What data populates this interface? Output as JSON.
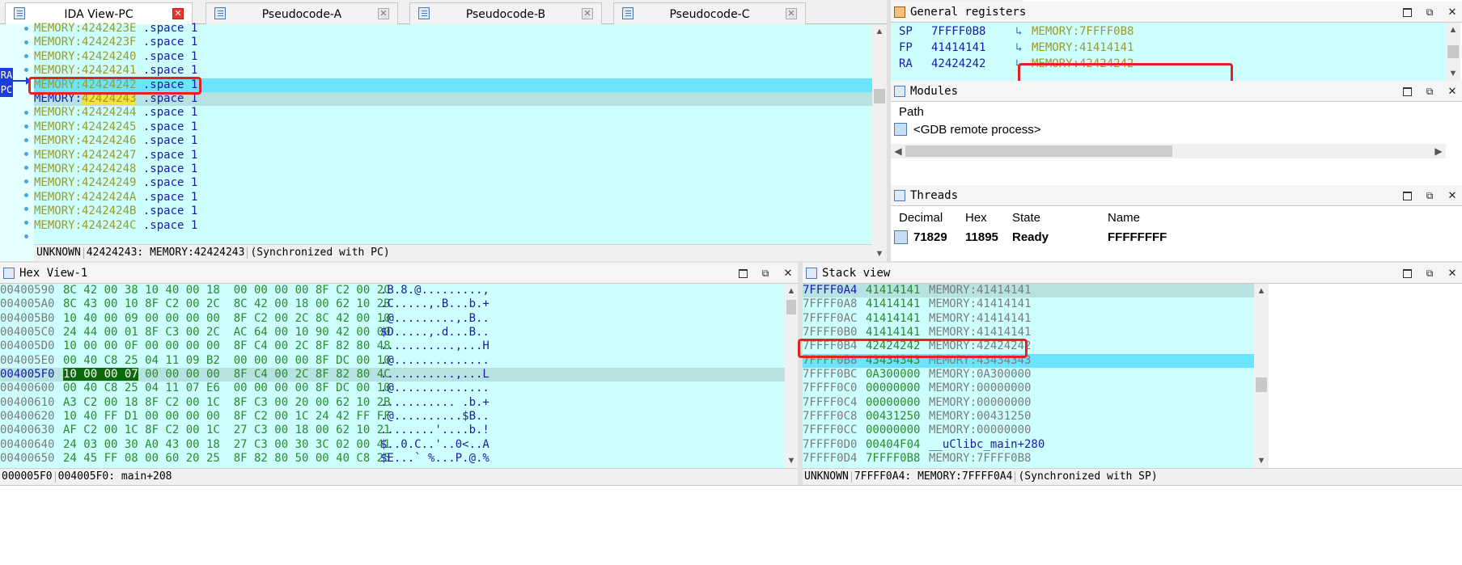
{
  "tabs": [
    {
      "label": "IDA View-PC",
      "active": true
    },
    {
      "label": "Pseudocode-A",
      "active": false
    },
    {
      "label": "Pseudocode-B",
      "active": false
    },
    {
      "label": "Pseudocode-C",
      "active": false
    }
  ],
  "ida_view": {
    "pc_marker": [
      "RA",
      "PC"
    ],
    "rows": [
      {
        "addr": "MEMORY:4242423E",
        "op": ".space 1"
      },
      {
        "addr": "MEMORY:4242423F",
        "op": ".space 1"
      },
      {
        "addr": "MEMORY:42424240",
        "op": ".space 1"
      },
      {
        "addr": "MEMORY:42424241",
        "op": ".space 1"
      },
      {
        "addr": "MEMORY:42424242",
        "op": ".space 1"
      },
      {
        "addr_prefix": "MEMORY:",
        "addr_hl": "42424243",
        "op": ".space 1"
      },
      {
        "addr": "MEMORY:42424244",
        "op": ".space 1"
      },
      {
        "addr": "MEMORY:42424245",
        "op": ".space 1"
      },
      {
        "addr": "MEMORY:42424246",
        "op": ".space 1"
      },
      {
        "addr": "MEMORY:42424247",
        "op": ".space 1"
      },
      {
        "addr": "MEMORY:42424248",
        "op": ".space 1"
      },
      {
        "addr": "MEMORY:42424249",
        "op": ".space 1"
      },
      {
        "addr": "MEMORY:4242424A",
        "op": ".space 1"
      },
      {
        "addr": "MEMORY:4242424B",
        "op": ".space 1"
      },
      {
        "addr": "MEMORY:4242424C",
        "op": ".space 1"
      }
    ],
    "status": {
      "part1": "UNKNOWN",
      "part2": "42424243: MEMORY:42424243",
      "part3": "(Synchronized with PC)"
    }
  },
  "registers": {
    "title": "General registers",
    "rows": [
      {
        "name": "SP",
        "value": "7FFFF0B8",
        "target": "MEMORY:7FFFF0B8"
      },
      {
        "name": "FP",
        "value": "41414141",
        "target": "MEMORY:41414141"
      },
      {
        "name": "RA",
        "value": "42424242",
        "target": "MEMORY:42424242"
      }
    ]
  },
  "modules": {
    "title": "Modules",
    "header": "Path",
    "item": "<GDB remote process>"
  },
  "threads": {
    "title": "Threads",
    "headers": [
      "Decimal",
      "Hex",
      "State",
      "Name"
    ],
    "row": {
      "decimal": "71829",
      "hex": "11895",
      "state": "Ready",
      "name": "FFFFFFFF"
    }
  },
  "hex_view": {
    "title": "Hex View-1",
    "rows": [
      {
        "addr": "00400590",
        "bytes": "8C 42 00 38 10 40 00 18  00 00 00 00 8F C2 00 2C",
        "ascii": ".B.8.@.........,"
      },
      {
        "addr": "004005A0",
        "bytes": "8C 43 00 10 8F C2 00 2C  8C 42 00 18 00 62 10 2B",
        "ascii": ".C.....,.B...b.+"
      },
      {
        "addr": "004005B0",
        "bytes": "10 40 00 09 00 00 00 00  8F C2 00 2C 8C 42 00 10",
        "ascii": ".@.........,.B.."
      },
      {
        "addr": "004005C0",
        "bytes": "24 44 00 01 8F C3 00 2C  AC 64 00 10 90 42 00 00",
        "ascii": "$D.....,.d...B.."
      },
      {
        "addr": "004005D0",
        "bytes": "10 00 00 0F 00 00 00 00  8F C4 00 2C 8F 82 80 48",
        "ascii": "...........,...H"
      },
      {
        "addr": "004005E0",
        "bytes": "00 40 C8 25 04 11 09 B2  00 00 00 00 8F DC 00 10",
        "ascii": ".@.............."
      },
      {
        "addr": "004005F0",
        "bytes_hl": "10 00 00 07",
        "bytes": " 00 00 00 00  8F C4 00 2C 8F 82 80 4C",
        "ascii": "...........,...L"
      },
      {
        "addr": "00400600",
        "bytes": "00 40 C8 25 04 11 07 E6  00 00 00 00 8F DC 00 10",
        "ascii": ".@.............."
      },
      {
        "addr": "00400610",
        "bytes": "A3 C2 00 18 8F C2 00 1C  8F C3 00 20 00 62 10 2B",
        "ascii": "........... .b.+"
      },
      {
        "addr": "00400620",
        "bytes": "10 40 FF D1 00 00 00 00  8F C2 00 1C 24 42 FF FF",
        "ascii": ".@..........$B.."
      },
      {
        "addr": "00400630",
        "bytes": "AF C2 00 1C 8F C2 00 1C  27 C3 00 18 00 62 10 21",
        "ascii": "........'....b.!"
      },
      {
        "addr": "00400640",
        "bytes": "24 03 00 30 A0 43 00 18  27 C3 00 30 3C 02 00 41",
        "ascii": "$..0.C..'..0<..A"
      },
      {
        "addr": "00400650",
        "bytes": "24 45 FF 08 00 60 20 25  8F 82 80 50 00 40 C8 25",
        "ascii": "$E...` %...P.@.%"
      }
    ],
    "status": {
      "part1": "000005F0",
      "part2": "004005F0: main+208"
    }
  },
  "stack_view": {
    "title": "Stack view",
    "rows": [
      {
        "addr": "7FFFF0A4",
        "value": "41414141",
        "target": "MEMORY:41414141"
      },
      {
        "addr": "7FFFF0A8",
        "value": "41414141",
        "target": "MEMORY:41414141"
      },
      {
        "addr": "7FFFF0AC",
        "value": "41414141",
        "target": "MEMORY:41414141"
      },
      {
        "addr": "7FFFF0B0",
        "value": "41414141",
        "target": "MEMORY:41414141"
      },
      {
        "addr": "7FFFF0B4",
        "value": "42424242",
        "target": "MEMORY:42424242"
      },
      {
        "addr": "7FFFF0B8",
        "value": "43434343",
        "target": "MEMORY:43434343"
      },
      {
        "addr": "7FFFF0BC",
        "value": "0A300000",
        "target": "MEMORY:0A300000"
      },
      {
        "addr": "7FFFF0C0",
        "value": "00000000",
        "target": "MEMORY:00000000"
      },
      {
        "addr": "7FFFF0C4",
        "value": "00000000",
        "target": "MEMORY:00000000"
      },
      {
        "addr": "7FFFF0C8",
        "value": "00431250",
        "target": "MEMORY:00431250"
      },
      {
        "addr": "7FFFF0CC",
        "value": "00000000",
        "target": "MEMORY:00000000"
      },
      {
        "addr": "7FFFF0D0",
        "value": "00404F04",
        "target": "__uClibc_main+280"
      },
      {
        "addr": "7FFFF0D4",
        "value": "7FFFF0B8",
        "target": "MEMORY:7FFFF0B8"
      }
    ],
    "status": {
      "part1": "UNKNOWN",
      "part2": "7FFFF0A4: MEMORY:7FFFF0A4",
      "part3": "(Synchronized with SP)"
    }
  },
  "colors": {
    "view_bg": "#cdffff",
    "current_line": "#6ce4ff",
    "selected_line": "#b6e2e2",
    "highlight_box": "#e52222",
    "pc_marker": "#1c3dd9"
  }
}
